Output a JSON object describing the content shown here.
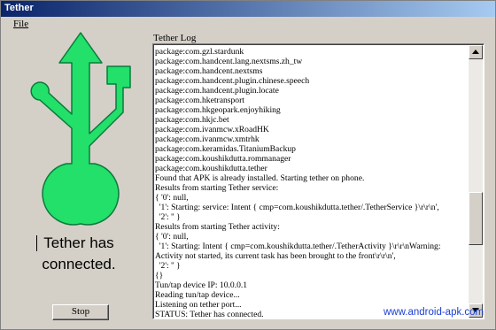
{
  "window": {
    "title": "Tether"
  },
  "menu": {
    "file_label": "File"
  },
  "status": {
    "line1": "Tether has",
    "line2": "connected."
  },
  "stop_button": {
    "label": "Stop"
  },
  "log": {
    "label": "Tether Log",
    "lines": [
      "package:com.gzl.stardunk",
      "package:com.handcent.lang.nextsms.zh_tw",
      "package:com.handcent.nextsms",
      "package:com.handcent.plugin.chinese.speech",
      "package:com.handcent.plugin.locate",
      "package:com.hketransport",
      "package:com.hkgeopark.enjoyhiking",
      "package:com.hkjc.bet",
      "package:com.ivanmcw.xRoadHK",
      "package:com.ivanmcw.xmtrhk",
      "package:com.keramidas.TitaniumBackup",
      "package:com.koushikdutta.rommanager",
      "package:com.koushikdutta.tether",
      "Found that APK is already installed. Starting tether on phone.",
      "Results from starting Tether service:",
      "{ '0': null,",
      "  '1': Starting: service: Intent { cmp=com.koushikdutta.tether/.TetherService }\\r\\r\\n',",
      "  '2': '' }",
      "Results from starting Tether activity:",
      "{ '0': null,",
      "  '1': Starting: Intent { cmp=com.koushikdutta.tether/.TetherActivity }\\r\\r\\nWarning:",
      "Activity not started, its current task has been brought to the front\\r\\r\\n',",
      "  '2': '' }",
      "{}",
      "Tun/tap device IP: 10.0.0.1",
      "Reading tun/tap device...",
      "Listening on tether port...",
      "STATUS: Tether has connected."
    ]
  },
  "watermark": "www.android-apk.com",
  "colors": {
    "logo_green": "#22e06a",
    "logo_outline": "#0a7a3a",
    "titlebar": "#0a246a"
  }
}
